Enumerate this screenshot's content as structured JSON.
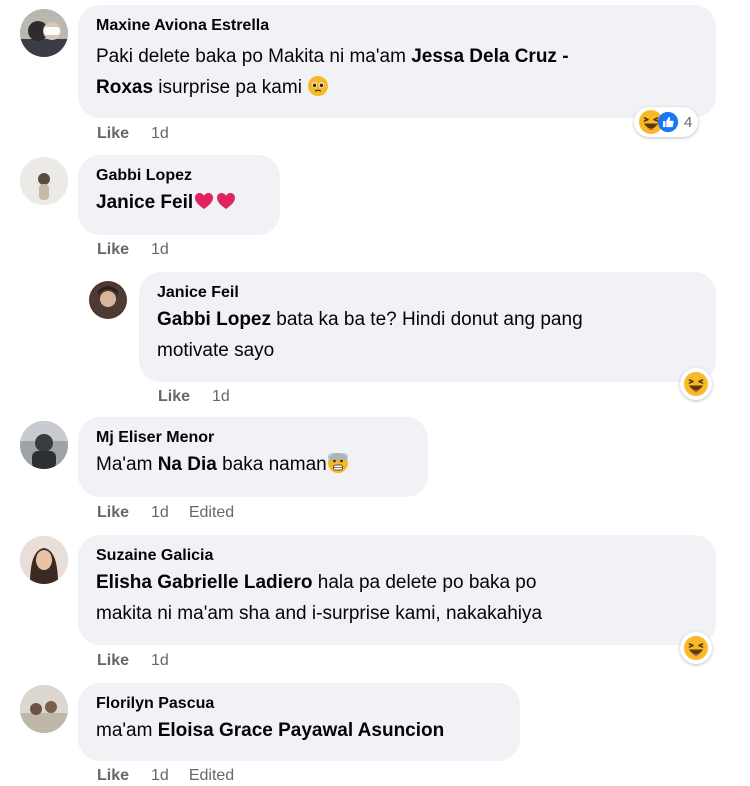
{
  "comments": [
    {
      "author": "Maxine Aviona Estrella",
      "line1_pre": "Paki delete baka po Makita ni ma'am ",
      "line1_mention": "Jessa Dela Cruz -",
      "line2_mention": "Roxas",
      "line2_post": " isurprise pa kami ",
      "like": "Like",
      "time": "1d",
      "reaction_count": "4"
    },
    {
      "author": "Gabbi Lopez",
      "mention": "Janice Feil",
      "like": "Like",
      "time": "1d"
    },
    {
      "author": "Janice Feil",
      "mention": "Gabbi Lopez",
      "line1_post": " bata ka ba te? Hindi donut ang pang",
      "line2": "motivate sayo",
      "like": "Like",
      "time": "1d"
    },
    {
      "author": "Mj Eliser Menor",
      "pre": "Ma'am ",
      "mention": "Na Dia",
      "post": " baka naman",
      "like": "Like",
      "time": "1d",
      "edited": "Edited"
    },
    {
      "author": "Suzaine Galicia",
      "mention": "Elisha Gabrielle Ladiero",
      "line1_post": " hala pa delete po baka po",
      "line2": "makita ni ma'am sha and i-surprise kami, nakakahiya",
      "like": "Like",
      "time": "1d"
    },
    {
      "author": "Florilyn Pascua",
      "pre": "ma'am ",
      "mention": "Eloisa Grace Payawal Asuncion",
      "like": "Like",
      "time": "1d",
      "edited": "Edited"
    }
  ],
  "icons": {
    "haha": "haha-emoji-icon",
    "like": "like-reaction-icon",
    "heart": "red-heart-emoji-icon",
    "pleading": "pleading-face-emoji-icon",
    "fearful": "fearful-face-emoji-icon"
  },
  "colors": {
    "bubble": "#f0f2f5",
    "meta_text": "#65676b",
    "like_blue": "#1877f2",
    "heart_red": "#e0245e",
    "emoji_yellow": "#f7b928"
  }
}
